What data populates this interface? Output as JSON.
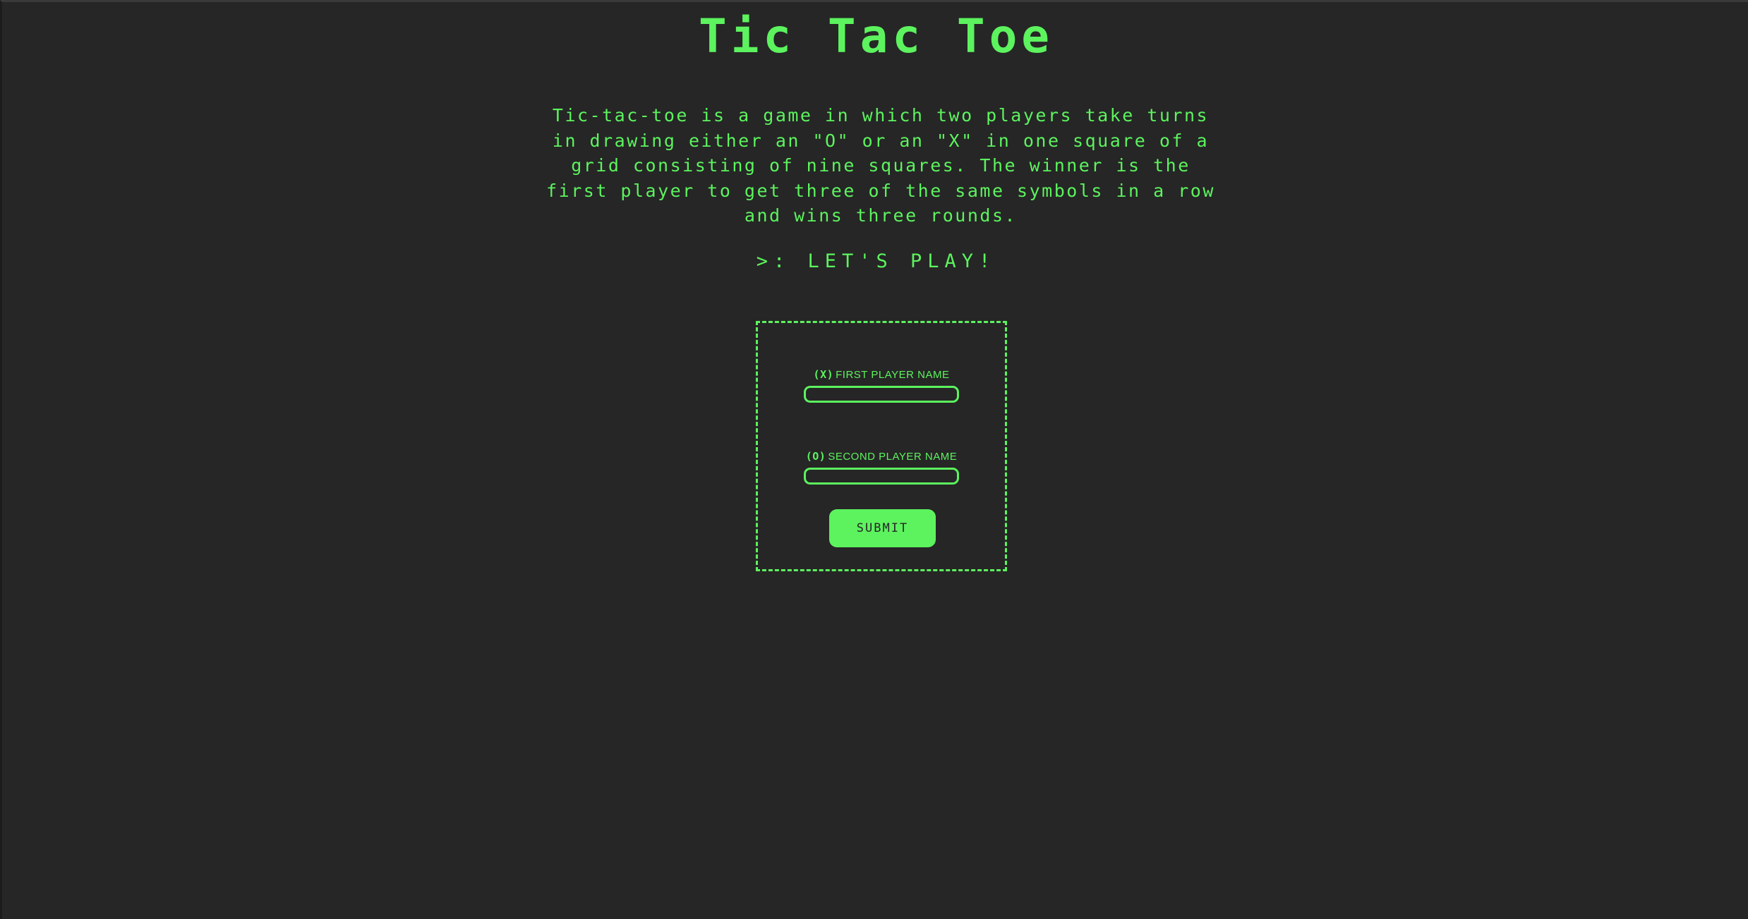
{
  "header": {
    "title": "Tic Tac Toe"
  },
  "intro": {
    "text": "Tic-tac-toe is a game in which two players take turns in drawing either an \"O\" or an \"X\" in one square of a grid consisting of nine squares. The winner is the first player to get three of the same symbols in a row and wins three rounds."
  },
  "cta": {
    "text": ">: LET'S PLAY!"
  },
  "form": {
    "player_one": {
      "symbol": "(X)",
      "label": "FIRST PLAYER NAME",
      "value": ""
    },
    "player_two": {
      "symbol": "(O)",
      "label": "SECOND PLAYER NAME",
      "value": ""
    },
    "submit_label": "SUBMIT"
  },
  "colors": {
    "background": "#262626",
    "accent": "#5cf35e"
  }
}
